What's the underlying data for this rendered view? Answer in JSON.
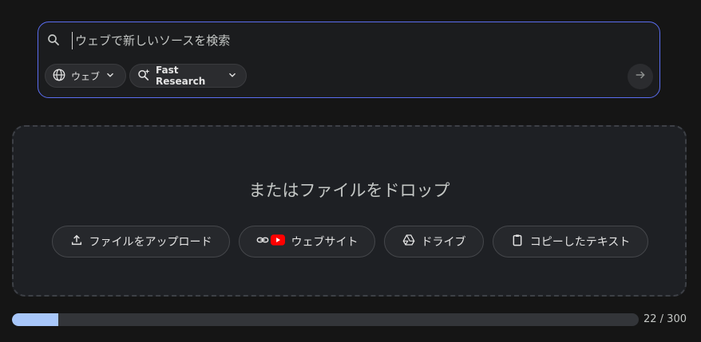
{
  "search": {
    "placeholder": "ウェブで新しいソースを検索",
    "value": ""
  },
  "chips": {
    "source_label": "ウェブ",
    "mode_label": "Fast Research"
  },
  "drop_zone": {
    "title": "またはファイルをドロップ",
    "buttons": [
      {
        "label": "ファイルをアップロード",
        "icon": "upload-icon"
      },
      {
        "label": "ウェブサイト",
        "icon": "link-youtube-icon"
      },
      {
        "label": "ドライブ",
        "icon": "drive-icon"
      },
      {
        "label": "コピーしたテキスト",
        "icon": "clipboard-icon"
      }
    ]
  },
  "progress": {
    "current": 22,
    "max": 300,
    "label": "22 / 300"
  },
  "colors": {
    "accent_border": "#5a6df0",
    "progress_fill": "#a8c7fa",
    "youtube_red": "#ff0000"
  }
}
